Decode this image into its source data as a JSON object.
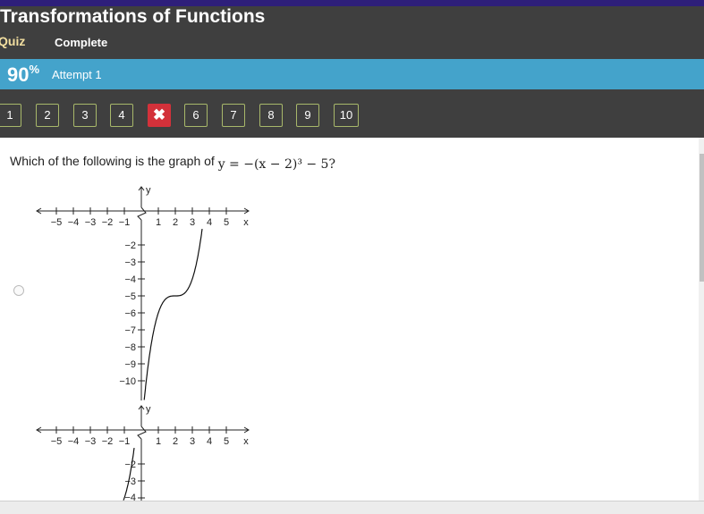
{
  "header": {
    "title": "Transformations of Functions",
    "section": "Quiz",
    "status": "Complete"
  },
  "score": {
    "value": "90",
    "unit": "%",
    "attempt": "Attempt 1"
  },
  "nav": {
    "questions": [
      {
        "label": "1",
        "state": "normal"
      },
      {
        "label": "2",
        "state": "normal"
      },
      {
        "label": "3",
        "state": "normal"
      },
      {
        "label": "4",
        "state": "normal"
      },
      {
        "label": "✖",
        "state": "incorrect"
      },
      {
        "label": "6",
        "state": "normal"
      },
      {
        "label": "7",
        "state": "normal"
      },
      {
        "label": "8",
        "state": "normal"
      },
      {
        "label": "9",
        "state": "normal"
      },
      {
        "label": "10",
        "state": "normal"
      }
    ]
  },
  "question": {
    "text": "Which of the following is the graph of",
    "equation": "y = −(x − 2)³ − 5?"
  },
  "graph": {
    "x_label": "x",
    "y_label": "y",
    "x_ticks": [
      "−5",
      "−4",
      "−3",
      "−2",
      "−1",
      "1",
      "2",
      "3",
      "4",
      "5"
    ],
    "y_ticks": [
      "−2",
      "−3",
      "−4",
      "−5",
      "−6",
      "−7",
      "−8",
      "−9",
      "−10"
    ]
  },
  "colors": {
    "header": "#3f3f3f",
    "scorebar": "#44a3cb",
    "incorrect": "#d3313a",
    "quiz_label": "#f3dfa0"
  }
}
